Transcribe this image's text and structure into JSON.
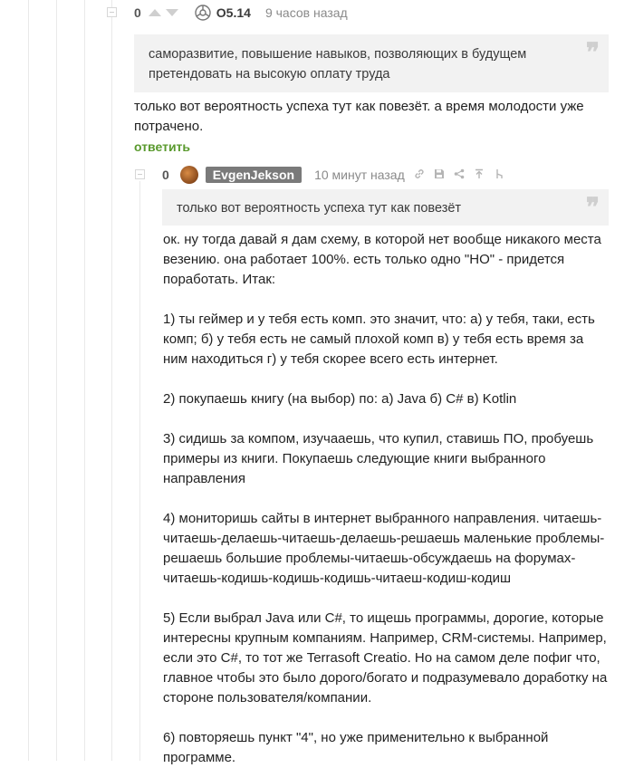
{
  "comment1": {
    "rating": "0",
    "nickname": "O5.14",
    "time": "9 часов назад",
    "quote": "саморазвитие, повышение навыков, позволяющих в будущем претендовать на высокую оплату труда",
    "text": "только вот вероятность успеха тут как повезёт. а время молодости уже потрачено.",
    "reply_label": "ответить"
  },
  "comment2": {
    "rating": "0",
    "nickname": "EvgenJekson",
    "time": "10 минут назад",
    "quote": "только вот вероятность успеха тут как повезёт",
    "paragraphs": [
      "ок. ну тогда давай я дам схему, в которой нет вообще никакого места везению. она работает 100%. есть только одно \"НО\" - придется поработать. Итак:",
      "1) ты геймер и у тебя есть комп. это значит, что: а) у тебя, таки, есть комп; б) у тебя есть не самый плохой комп в) у тебя есть время за ним находиться г) у тебя скорее всего есть интернет.",
      "2) покупаешь книгу (на выбор) по: а) Java б) C# в) Kotlin",
      "3) сидишь за компом, изучааешь, что купил, ставишь ПО, пробуешь примеры из книги. Покупаешь следующие книги выбранного направления",
      "4) мониторишь сайты в интернет выбранного направления. читаешь-читаешь-делаешь-читаешь-делаешь-решаешь маленькие проблемы-решаешь большие проблемы-читаешь-обсуждаешь на форумах-читаешь-кодишь-кодишь-кодишь-читаеш-кодиш-кодиш",
      "5) Если выбрал Java или C#, то ищешь программы, дорогие, которые интересны крупным компаниям. Например, CRM-системы. Например, если это C#, то тот же Terrasoft Creatio. Но на самом деле пофиг что, главное чтобы это было дорого/богато и подразумевало доработку на стороне пользователя/компании.",
      "6) повторяешь пункт \"4\", но уже применительно к выбранной программе."
    ]
  },
  "icons": {
    "quote": "quote-icon",
    "link": "link-icon",
    "save": "save-icon",
    "share": "share-icon",
    "up": "go-to-parent-icon",
    "branch": "branch-icon"
  },
  "colors": {
    "reply_link": "#5a9a2e",
    "quote_bg": "#f2f2f2",
    "nick_badge_bg": "#7a7a7a"
  }
}
